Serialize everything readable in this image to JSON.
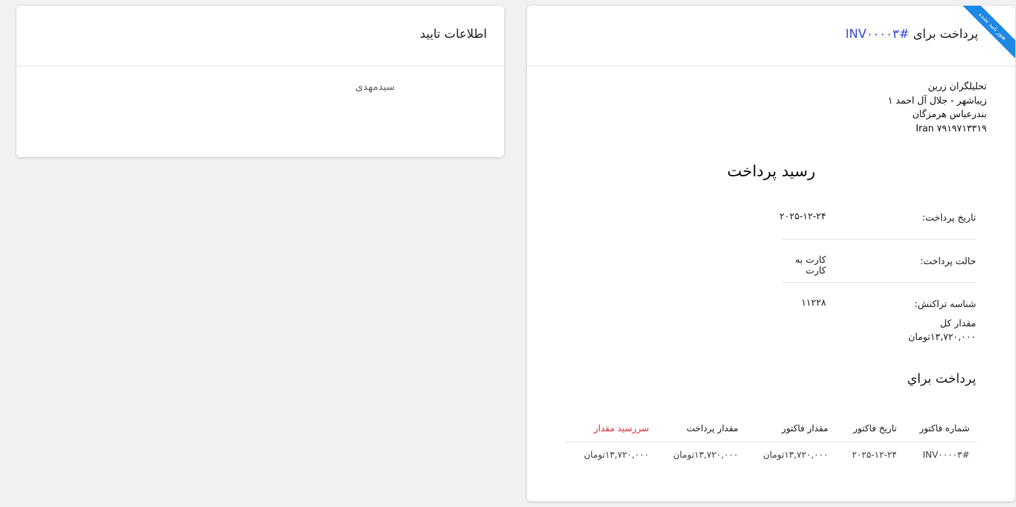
{
  "confirm": {
    "title": "اطلاعات تایید",
    "name": "سیدمهدی"
  },
  "payment": {
    "title_prefix": "پرداخت برای",
    "invoice_ref": "#INV۰۰۰۰۳",
    "ribbon": "هنوز تایید نشده",
    "address": {
      "company": "تحلیلگران زرین",
      "street": "زیباشهر - جلال آل احمد ۱",
      "city": "بندرعباس هرمزگان",
      "postal": "Iran ۷۹۱۹۷۱۳۳۱۹"
    },
    "receipt_title": "رسید پرداخت",
    "date_label": "تاریخ پرداخت:",
    "date_value": "۲۰۲۵-۱۲-۲۴",
    "mode_label": "حالت پرداخت:",
    "mode_value": "کارت به کارت",
    "txn_label": "شناسه تراکنش:",
    "txn_value": "۱۱۲۲۸",
    "total_label": "مقدار کل",
    "total_value": "۱۳,۷۲۰,۰۰۰تومان",
    "paid_for": "پرداخت براي",
    "table": {
      "headers": [
        "شماره فاکتور",
        "تاریخ فاکتور",
        "مقدار فاکتور",
        "مقدار پرداخت",
        "سررسید مقدار"
      ],
      "rows": [
        [
          "#INV۰۰۰۰۳",
          "۲۰۲۵-۱۲-۲۴",
          "۱۳,۷۲۰,۰۰۰تومان",
          "۱۳,۷۲۰,۰۰۰تومان",
          "۱۳,۷۲۰,۰۰۰تومان"
        ]
      ]
    },
    "colors": {
      "link": "#2f4bd8",
      "ribbon": "#1e88e5",
      "due": "#e0303a"
    }
  }
}
